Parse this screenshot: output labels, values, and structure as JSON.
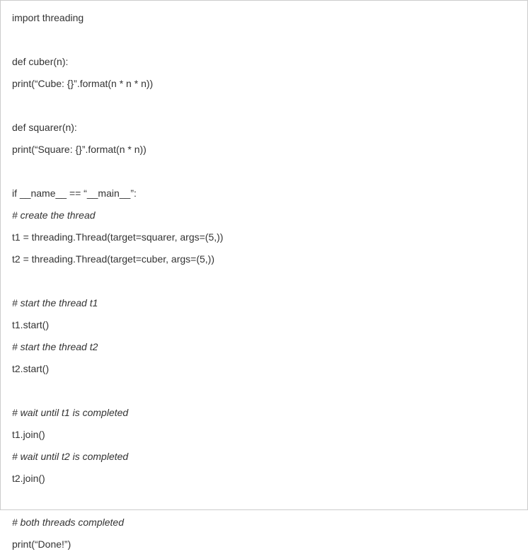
{
  "code": {
    "lines": [
      {
        "text": "import threading",
        "type": "code"
      },
      {
        "text": "",
        "type": "blank"
      },
      {
        "text": "def cuber(n):",
        "type": "code"
      },
      {
        "text": "print(“Cube: {}”.format(n * n * n))",
        "type": "code"
      },
      {
        "text": "",
        "type": "blank"
      },
      {
        "text": "def squarer(n):",
        "type": "code"
      },
      {
        "text": "print(“Square: {}”.format(n * n))",
        "type": "code"
      },
      {
        "text": "",
        "type": "blank"
      },
      {
        "text": "if __name__ == “__main__”:",
        "type": "code"
      },
      {
        "text": "# create the thread",
        "type": "comment"
      },
      {
        "text": "t1 = threading.Thread(target=squarer, args=(5,))",
        "type": "code"
      },
      {
        "text": "t2 = threading.Thread(target=cuber, args=(5,))",
        "type": "code"
      },
      {
        "text": "",
        "type": "blank"
      },
      {
        "text": "# start the thread t1",
        "type": "comment"
      },
      {
        "text": "t1.start()",
        "type": "code"
      },
      {
        "text": "# start the thread t2",
        "type": "comment"
      },
      {
        "text": "t2.start()",
        "type": "code"
      },
      {
        "text": "",
        "type": "blank"
      },
      {
        "text": "# wait until t1 is completed",
        "type": "comment"
      },
      {
        "text": "t1.join()",
        "type": "code"
      },
      {
        "text": "# wait until t2 is completed",
        "type": "comment"
      },
      {
        "text": "t2.join()",
        "type": "code"
      },
      {
        "text": "",
        "type": "blank"
      },
      {
        "text": "# both threads completed",
        "type": "comment"
      },
      {
        "text": "print(“Done!”)",
        "type": "code"
      }
    ]
  }
}
